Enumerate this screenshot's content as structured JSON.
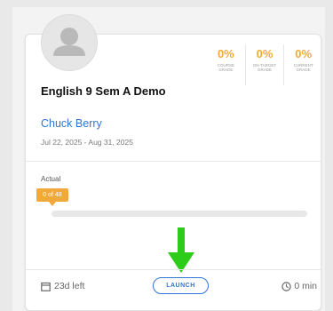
{
  "course": {
    "title": "English 9 Sem A Demo",
    "teacher": "Chuck Berry",
    "dates": "Jul 22, 2025 - Aug 31, 2025",
    "avatar_icon": "user-avatar-icon"
  },
  "stats": [
    {
      "value": "0%",
      "label": "COURSE GRADE"
    },
    {
      "value": "0%",
      "label": "ON-TARGET GRADE"
    },
    {
      "value": "0%",
      "label": "CURRENT GRADE"
    }
  ],
  "progress": {
    "label": "Actual",
    "badge": "0 of 48",
    "fraction": 0
  },
  "footer": {
    "days_left": "23d left",
    "launch_label": "LAUNCH",
    "time": "0 min",
    "calendar_icon": "calendar-icon",
    "clock_icon": "clock-icon"
  },
  "annotation": {
    "arrow_icon": "down-arrow-icon",
    "color": "#2ecc1a"
  },
  "colors": {
    "accent": "#f2a93b",
    "link": "#2f76d6"
  }
}
